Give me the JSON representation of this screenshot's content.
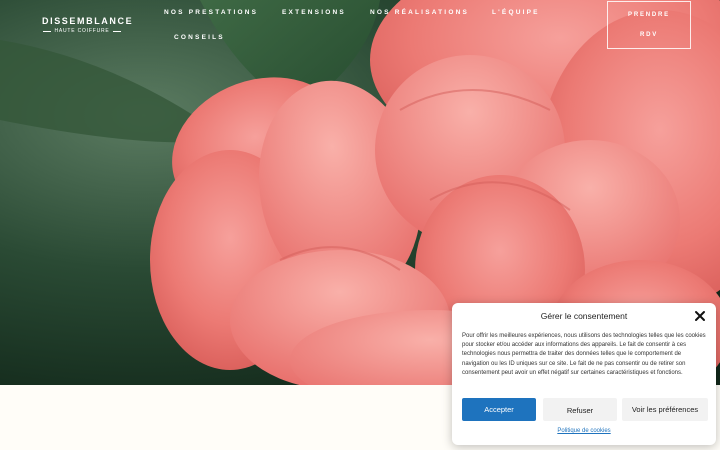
{
  "header": {
    "logo_name": "DISSEMBLANCE",
    "logo_sub": "HAUTE COIFFURE",
    "nav": [
      {
        "label": "NOS PRESTATIONS"
      },
      {
        "label": "EXTENSIONS"
      },
      {
        "label": "NOS RÉALISATIONS"
      },
      {
        "label": "L'ÉQUIPE"
      },
      {
        "label": "CONSEILS"
      }
    ],
    "cta_line1": "PRENDRE",
    "cta_line2": "RDV"
  },
  "consent": {
    "title": "Gérer le consentement",
    "body": "Pour offrir les meilleures expériences, nous utilisons des technologies telles que les cookies pour stocker et/ou accéder aux informations des appareils. Le fait de consentir à ces technologies nous permettra de traiter des données telles que le comportement de navigation ou les ID uniques sur ce site. Le fait de ne pas consentir ou de retirer son consentement peut avoir un effet négatif sur certaines caractéristiques et fonctions.",
    "accept_label": "Accepter",
    "refuse_label": "Refuser",
    "prefs_label": "Voir les préférences",
    "policy_label": "Politique de cookies"
  },
  "colors": {
    "accent": "#1e73be",
    "petal": "#f07a78",
    "foliage": "#2f5b3c"
  }
}
